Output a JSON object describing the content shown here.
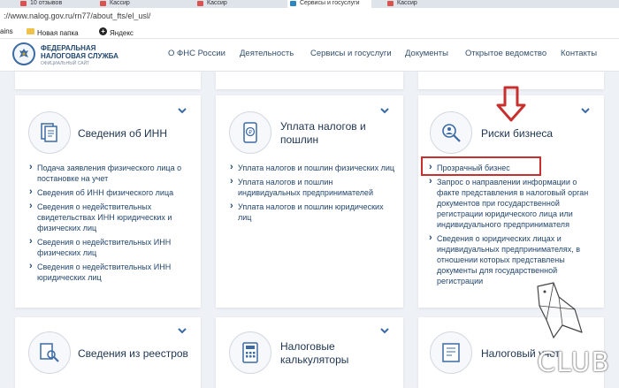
{
  "browser": {
    "tabs": [
      {
        "label": "10 отзывов"
      },
      {
        "label": "Кассир"
      },
      {
        "label": "Кассир"
      },
      {
        "label": "Сервисы и госуслуги"
      },
      {
        "label": "Кассир"
      }
    ],
    "url": "://www.nalog.gov.ru/rn77/about_fts/el_usl/",
    "bookmarks": [
      "ains",
      "Новая папка",
      "Яндекс"
    ]
  },
  "header": {
    "brand_line1": "ФЕДЕРАЛЬНАЯ",
    "brand_line2": "НАЛОГОВАЯ СЛУЖБА",
    "brand_sub": "ОФИЦИАЛЬНЫЙ САЙТ",
    "menu": [
      "О ФНС России",
      "Деятельность",
      "Сервисы и госуслуги",
      "Документы",
      "Открытое ведомство",
      "Контакты"
    ]
  },
  "cards": {
    "inn": {
      "title": "Сведения об ИНН",
      "items": [
        "Подача заявления физического лица о постановке на учет",
        "Сведения об ИНН физического лица",
        "Сведения о недействительных свидетельствах ИНН юридических и физических лиц",
        "Сведения о недействительных ИНН физических лиц",
        "Сведения о недействительных ИНН юридических лиц"
      ]
    },
    "taxes": {
      "title_line1": "Уплата налогов и",
      "title_line2": "пошлин",
      "items": [
        "Уплата налогов и пошлин физических лиц",
        "Уплата налогов и пошлин индивидуальных предпринимателей",
        "Уплата налогов и пошлин юридических лиц"
      ]
    },
    "risks": {
      "title": "Риски бизнеса",
      "items": [
        "Прозрачный бизнес",
        "Запрос о направлении информации о факте представления в налоговый орган документов при государственной регистрации юридического лица или индивидуального предпринимателя",
        "Сведения о юридических лицах и индивидуальных предпринимателях, в отношении которых представлены документы для государственной регистрации"
      ]
    },
    "registries": {
      "title": "Сведения из реестров"
    },
    "calculators": {
      "title_line1": "Налоговые",
      "title_line2": "калькуляторы"
    },
    "accounting": {
      "title": "Налоговый учет"
    }
  },
  "watermark": {
    "text": "CLUB"
  },
  "colors": {
    "accent": "#3b6aa5",
    "highlight": "#c83030",
    "link": "#24476e"
  }
}
